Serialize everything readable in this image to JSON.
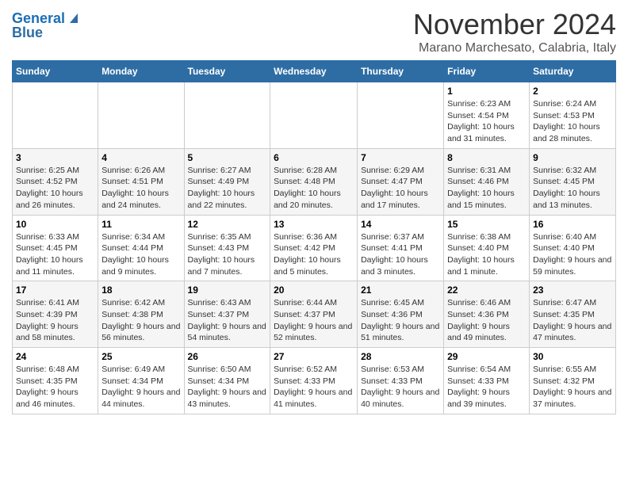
{
  "logo": {
    "line1": "General",
    "line2": "Blue"
  },
  "title": "November 2024",
  "location": "Marano Marchesato, Calabria, Italy",
  "days_header": [
    "Sunday",
    "Monday",
    "Tuesday",
    "Wednesday",
    "Thursday",
    "Friday",
    "Saturday"
  ],
  "weeks": [
    [
      {
        "num": "",
        "info": ""
      },
      {
        "num": "",
        "info": ""
      },
      {
        "num": "",
        "info": ""
      },
      {
        "num": "",
        "info": ""
      },
      {
        "num": "",
        "info": ""
      },
      {
        "num": "1",
        "info": "Sunrise: 6:23 AM\nSunset: 4:54 PM\nDaylight: 10 hours and 31 minutes."
      },
      {
        "num": "2",
        "info": "Sunrise: 6:24 AM\nSunset: 4:53 PM\nDaylight: 10 hours and 28 minutes."
      }
    ],
    [
      {
        "num": "3",
        "info": "Sunrise: 6:25 AM\nSunset: 4:52 PM\nDaylight: 10 hours and 26 minutes."
      },
      {
        "num": "4",
        "info": "Sunrise: 6:26 AM\nSunset: 4:51 PM\nDaylight: 10 hours and 24 minutes."
      },
      {
        "num": "5",
        "info": "Sunrise: 6:27 AM\nSunset: 4:49 PM\nDaylight: 10 hours and 22 minutes."
      },
      {
        "num": "6",
        "info": "Sunrise: 6:28 AM\nSunset: 4:48 PM\nDaylight: 10 hours and 20 minutes."
      },
      {
        "num": "7",
        "info": "Sunrise: 6:29 AM\nSunset: 4:47 PM\nDaylight: 10 hours and 17 minutes."
      },
      {
        "num": "8",
        "info": "Sunrise: 6:31 AM\nSunset: 4:46 PM\nDaylight: 10 hours and 15 minutes."
      },
      {
        "num": "9",
        "info": "Sunrise: 6:32 AM\nSunset: 4:45 PM\nDaylight: 10 hours and 13 minutes."
      }
    ],
    [
      {
        "num": "10",
        "info": "Sunrise: 6:33 AM\nSunset: 4:45 PM\nDaylight: 10 hours and 11 minutes."
      },
      {
        "num": "11",
        "info": "Sunrise: 6:34 AM\nSunset: 4:44 PM\nDaylight: 10 hours and 9 minutes."
      },
      {
        "num": "12",
        "info": "Sunrise: 6:35 AM\nSunset: 4:43 PM\nDaylight: 10 hours and 7 minutes."
      },
      {
        "num": "13",
        "info": "Sunrise: 6:36 AM\nSunset: 4:42 PM\nDaylight: 10 hours and 5 minutes."
      },
      {
        "num": "14",
        "info": "Sunrise: 6:37 AM\nSunset: 4:41 PM\nDaylight: 10 hours and 3 minutes."
      },
      {
        "num": "15",
        "info": "Sunrise: 6:38 AM\nSunset: 4:40 PM\nDaylight: 10 hours and 1 minute."
      },
      {
        "num": "16",
        "info": "Sunrise: 6:40 AM\nSunset: 4:40 PM\nDaylight: 9 hours and 59 minutes."
      }
    ],
    [
      {
        "num": "17",
        "info": "Sunrise: 6:41 AM\nSunset: 4:39 PM\nDaylight: 9 hours and 58 minutes."
      },
      {
        "num": "18",
        "info": "Sunrise: 6:42 AM\nSunset: 4:38 PM\nDaylight: 9 hours and 56 minutes."
      },
      {
        "num": "19",
        "info": "Sunrise: 6:43 AM\nSunset: 4:37 PM\nDaylight: 9 hours and 54 minutes."
      },
      {
        "num": "20",
        "info": "Sunrise: 6:44 AM\nSunset: 4:37 PM\nDaylight: 9 hours and 52 minutes."
      },
      {
        "num": "21",
        "info": "Sunrise: 6:45 AM\nSunset: 4:36 PM\nDaylight: 9 hours and 51 minutes."
      },
      {
        "num": "22",
        "info": "Sunrise: 6:46 AM\nSunset: 4:36 PM\nDaylight: 9 hours and 49 minutes."
      },
      {
        "num": "23",
        "info": "Sunrise: 6:47 AM\nSunset: 4:35 PM\nDaylight: 9 hours and 47 minutes."
      }
    ],
    [
      {
        "num": "24",
        "info": "Sunrise: 6:48 AM\nSunset: 4:35 PM\nDaylight: 9 hours and 46 minutes."
      },
      {
        "num": "25",
        "info": "Sunrise: 6:49 AM\nSunset: 4:34 PM\nDaylight: 9 hours and 44 minutes."
      },
      {
        "num": "26",
        "info": "Sunrise: 6:50 AM\nSunset: 4:34 PM\nDaylight: 9 hours and 43 minutes."
      },
      {
        "num": "27",
        "info": "Sunrise: 6:52 AM\nSunset: 4:33 PM\nDaylight: 9 hours and 41 minutes."
      },
      {
        "num": "28",
        "info": "Sunrise: 6:53 AM\nSunset: 4:33 PM\nDaylight: 9 hours and 40 minutes."
      },
      {
        "num": "29",
        "info": "Sunrise: 6:54 AM\nSunset: 4:33 PM\nDaylight: 9 hours and 39 minutes."
      },
      {
        "num": "30",
        "info": "Sunrise: 6:55 AM\nSunset: 4:32 PM\nDaylight: 9 hours and 37 minutes."
      }
    ]
  ]
}
